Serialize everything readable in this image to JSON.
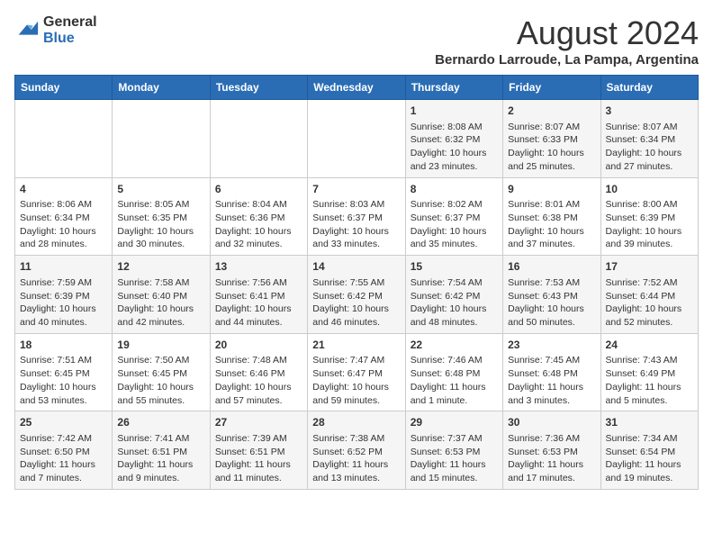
{
  "header": {
    "logo_line1": "General",
    "logo_line2": "Blue",
    "month_title": "August 2024",
    "subtitle": "Bernardo Larroude, La Pampa, Argentina"
  },
  "weekdays": [
    "Sunday",
    "Monday",
    "Tuesday",
    "Wednesday",
    "Thursday",
    "Friday",
    "Saturday"
  ],
  "weeks": [
    [
      {
        "day": "",
        "info": ""
      },
      {
        "day": "",
        "info": ""
      },
      {
        "day": "",
        "info": ""
      },
      {
        "day": "",
        "info": ""
      },
      {
        "day": "1",
        "info": "Sunrise: 8:08 AM\nSunset: 6:32 PM\nDaylight: 10 hours\nand 23 minutes."
      },
      {
        "day": "2",
        "info": "Sunrise: 8:07 AM\nSunset: 6:33 PM\nDaylight: 10 hours\nand 25 minutes."
      },
      {
        "day": "3",
        "info": "Sunrise: 8:07 AM\nSunset: 6:34 PM\nDaylight: 10 hours\nand 27 minutes."
      }
    ],
    [
      {
        "day": "4",
        "info": "Sunrise: 8:06 AM\nSunset: 6:34 PM\nDaylight: 10 hours\nand 28 minutes."
      },
      {
        "day": "5",
        "info": "Sunrise: 8:05 AM\nSunset: 6:35 PM\nDaylight: 10 hours\nand 30 minutes."
      },
      {
        "day": "6",
        "info": "Sunrise: 8:04 AM\nSunset: 6:36 PM\nDaylight: 10 hours\nand 32 minutes."
      },
      {
        "day": "7",
        "info": "Sunrise: 8:03 AM\nSunset: 6:37 PM\nDaylight: 10 hours\nand 33 minutes."
      },
      {
        "day": "8",
        "info": "Sunrise: 8:02 AM\nSunset: 6:37 PM\nDaylight: 10 hours\nand 35 minutes."
      },
      {
        "day": "9",
        "info": "Sunrise: 8:01 AM\nSunset: 6:38 PM\nDaylight: 10 hours\nand 37 minutes."
      },
      {
        "day": "10",
        "info": "Sunrise: 8:00 AM\nSunset: 6:39 PM\nDaylight: 10 hours\nand 39 minutes."
      }
    ],
    [
      {
        "day": "11",
        "info": "Sunrise: 7:59 AM\nSunset: 6:39 PM\nDaylight: 10 hours\nand 40 minutes."
      },
      {
        "day": "12",
        "info": "Sunrise: 7:58 AM\nSunset: 6:40 PM\nDaylight: 10 hours\nand 42 minutes."
      },
      {
        "day": "13",
        "info": "Sunrise: 7:56 AM\nSunset: 6:41 PM\nDaylight: 10 hours\nand 44 minutes."
      },
      {
        "day": "14",
        "info": "Sunrise: 7:55 AM\nSunset: 6:42 PM\nDaylight: 10 hours\nand 46 minutes."
      },
      {
        "day": "15",
        "info": "Sunrise: 7:54 AM\nSunset: 6:42 PM\nDaylight: 10 hours\nand 48 minutes."
      },
      {
        "day": "16",
        "info": "Sunrise: 7:53 AM\nSunset: 6:43 PM\nDaylight: 10 hours\nand 50 minutes."
      },
      {
        "day": "17",
        "info": "Sunrise: 7:52 AM\nSunset: 6:44 PM\nDaylight: 10 hours\nand 52 minutes."
      }
    ],
    [
      {
        "day": "18",
        "info": "Sunrise: 7:51 AM\nSunset: 6:45 PM\nDaylight: 10 hours\nand 53 minutes."
      },
      {
        "day": "19",
        "info": "Sunrise: 7:50 AM\nSunset: 6:45 PM\nDaylight: 10 hours\nand 55 minutes."
      },
      {
        "day": "20",
        "info": "Sunrise: 7:48 AM\nSunset: 6:46 PM\nDaylight: 10 hours\nand 57 minutes."
      },
      {
        "day": "21",
        "info": "Sunrise: 7:47 AM\nSunset: 6:47 PM\nDaylight: 10 hours\nand 59 minutes."
      },
      {
        "day": "22",
        "info": "Sunrise: 7:46 AM\nSunset: 6:48 PM\nDaylight: 11 hours\nand 1 minute."
      },
      {
        "day": "23",
        "info": "Sunrise: 7:45 AM\nSunset: 6:48 PM\nDaylight: 11 hours\nand 3 minutes."
      },
      {
        "day": "24",
        "info": "Sunrise: 7:43 AM\nSunset: 6:49 PM\nDaylight: 11 hours\nand 5 minutes."
      }
    ],
    [
      {
        "day": "25",
        "info": "Sunrise: 7:42 AM\nSunset: 6:50 PM\nDaylight: 11 hours\nand 7 minutes."
      },
      {
        "day": "26",
        "info": "Sunrise: 7:41 AM\nSunset: 6:51 PM\nDaylight: 11 hours\nand 9 minutes."
      },
      {
        "day": "27",
        "info": "Sunrise: 7:39 AM\nSunset: 6:51 PM\nDaylight: 11 hours\nand 11 minutes."
      },
      {
        "day": "28",
        "info": "Sunrise: 7:38 AM\nSunset: 6:52 PM\nDaylight: 11 hours\nand 13 minutes."
      },
      {
        "day": "29",
        "info": "Sunrise: 7:37 AM\nSunset: 6:53 PM\nDaylight: 11 hours\nand 15 minutes."
      },
      {
        "day": "30",
        "info": "Sunrise: 7:36 AM\nSunset: 6:53 PM\nDaylight: 11 hours\nand 17 minutes."
      },
      {
        "day": "31",
        "info": "Sunrise: 7:34 AM\nSunset: 6:54 PM\nDaylight: 11 hours\nand 19 minutes."
      }
    ]
  ]
}
